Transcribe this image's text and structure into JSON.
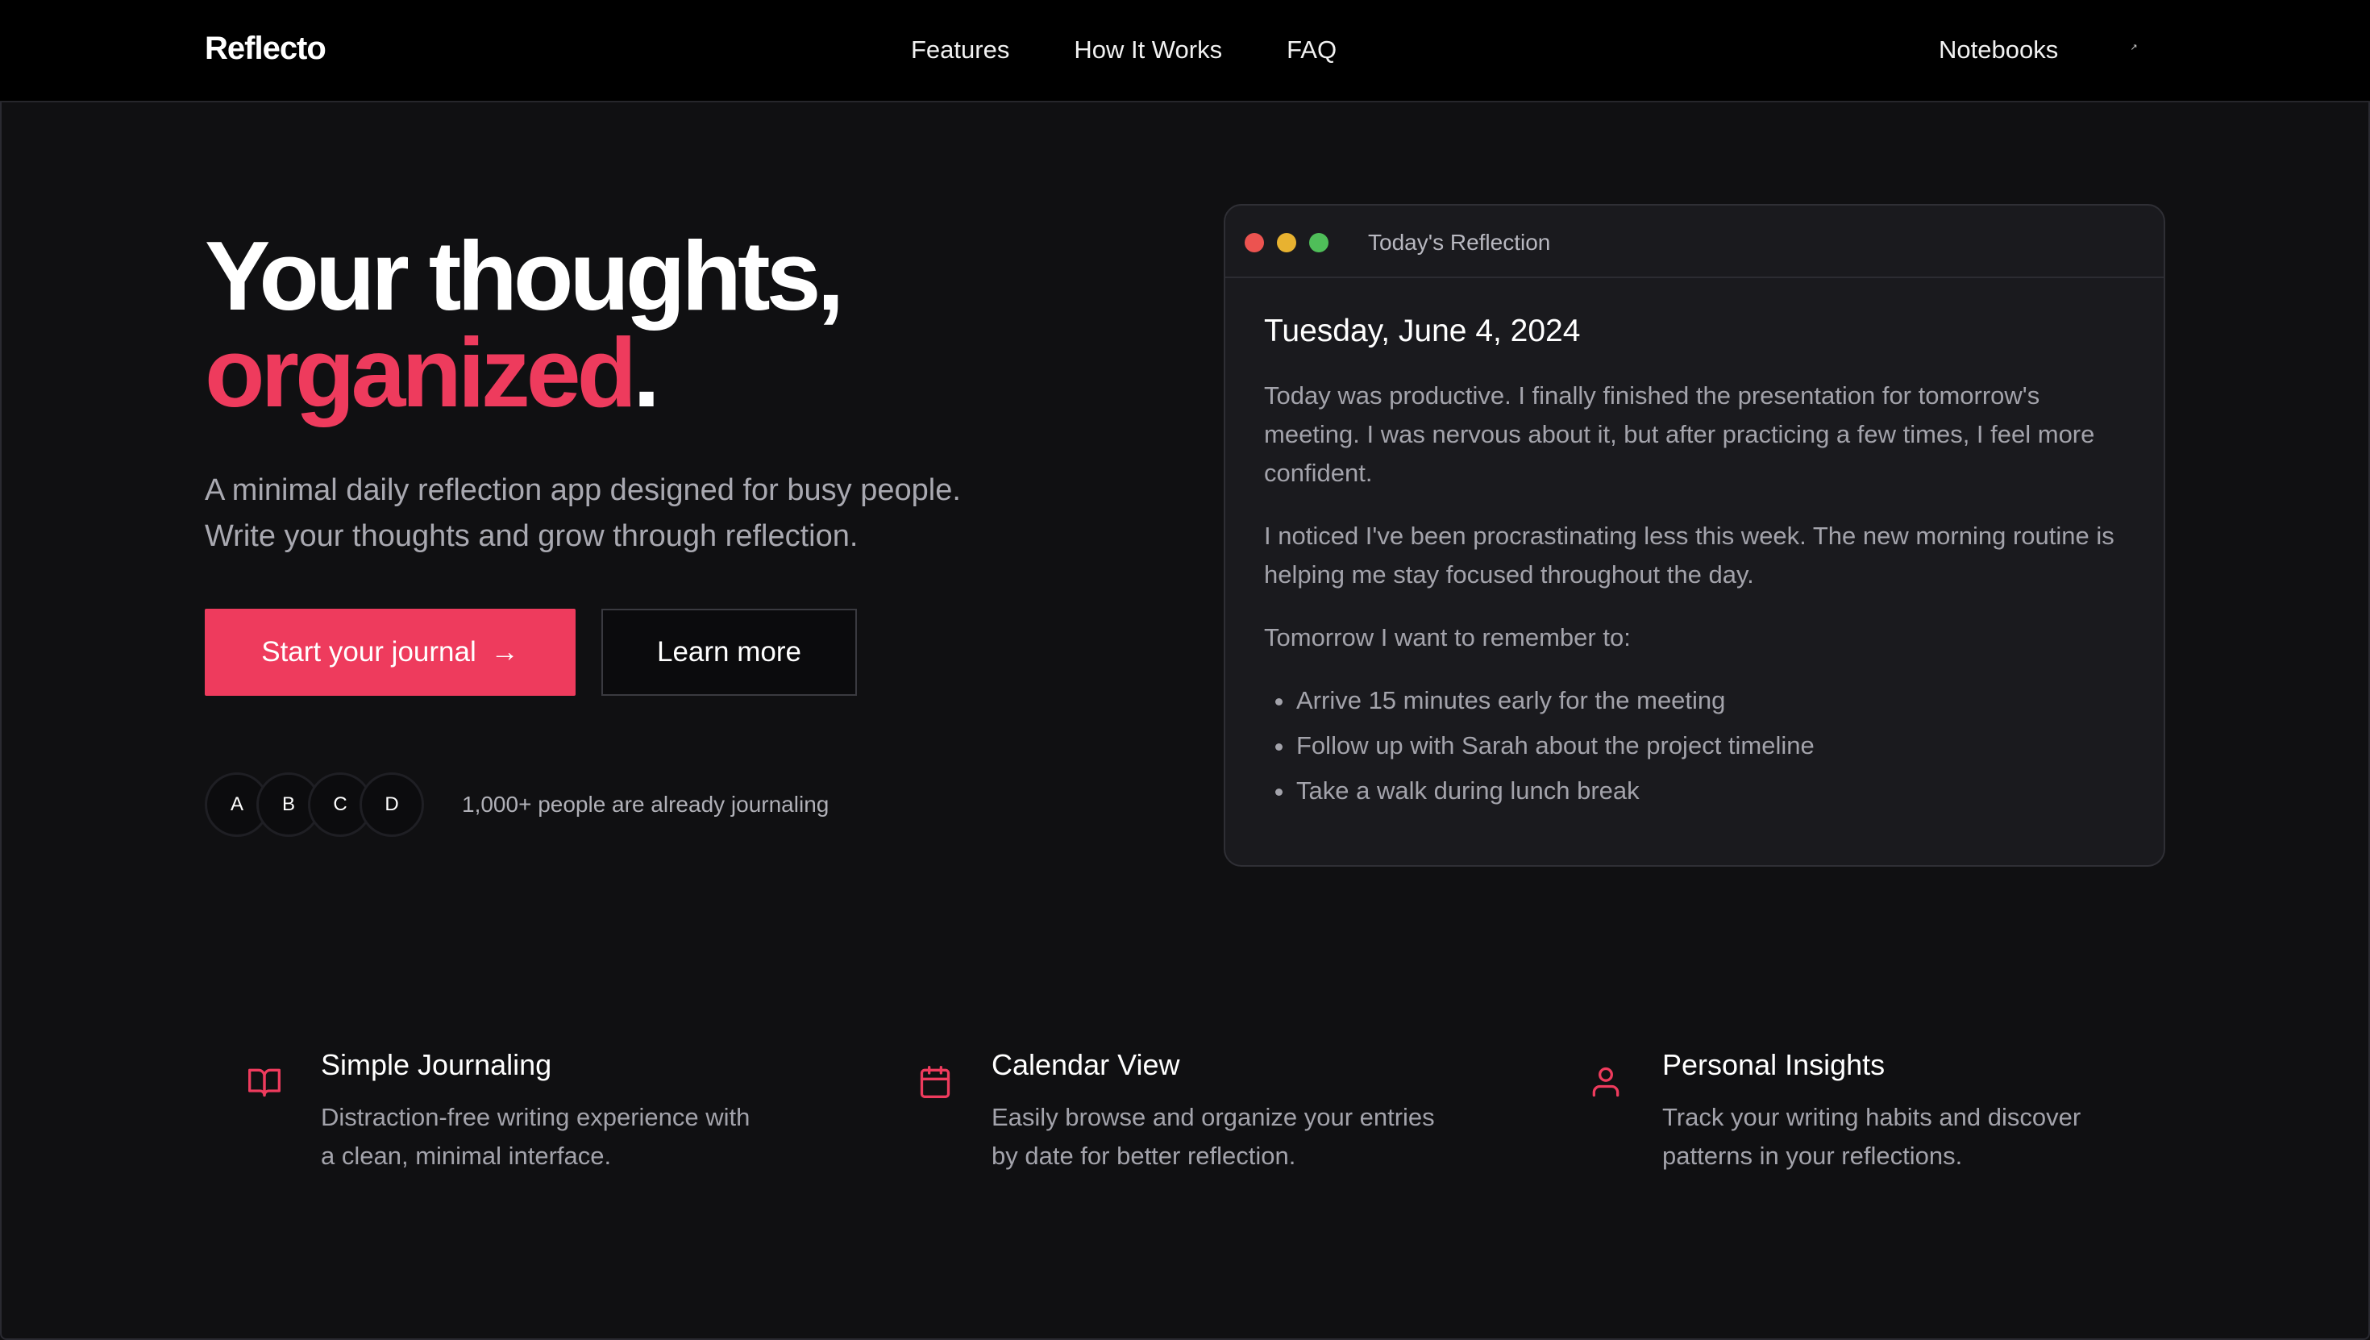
{
  "nav": {
    "brand": "Reflecto",
    "links": [
      "Features",
      "How It Works",
      "FAQ"
    ],
    "notebooks": "Notebooks",
    "profile_glyph": "↗"
  },
  "hero": {
    "title_line1": "Your thoughts,",
    "title_accent": "organized",
    "title_period": ".",
    "subtitle_line1": "A minimal daily reflection app designed for busy people.",
    "subtitle_line2": "Write your thoughts and grow through reflection.",
    "primary_button": "Start your journal",
    "primary_arrow": "→",
    "secondary_button": "Learn more",
    "avatars": [
      "A",
      "B",
      "C",
      "D"
    ],
    "social_proof": "1,000+ people are already journaling"
  },
  "card": {
    "window_title": "Today's Reflection",
    "date": "Tuesday, June 4, 2024",
    "paragraph1": "Today was productive. I finally finished the presentation for tomorrow's meeting. I was nervous about it, but after practicing a few times, I feel more confident.",
    "paragraph2": "I noticed I've been procrastinating less this week. The new morning routine is helping me stay focused throughout the day.",
    "paragraph3": "Tomorrow I want to remember to:",
    "list": [
      "Arrive 15 minutes early for the meeting",
      "Follow up with Sarah about the project timeline",
      "Take a walk during lunch break"
    ]
  },
  "features": [
    {
      "icon": "book-open-icon",
      "title": "Simple Journaling",
      "desc_line1": "Distraction-free writing experience with",
      "desc_line2": "a clean, minimal interface."
    },
    {
      "icon": "calendar-icon",
      "title": "Calendar View",
      "desc_line1": "Easily browse and organize your entries",
      "desc_line2": "by date for better reflection."
    },
    {
      "icon": "user-icon",
      "title": "Personal Insights",
      "desc_line1": "Track your writing habits and discover",
      "desc_line2": "patterns in your reflections."
    }
  ],
  "colors": {
    "accent": "#ee3b5d",
    "background": "#101012",
    "nav_background": "#000000",
    "card_background": "#1a1a1e"
  }
}
